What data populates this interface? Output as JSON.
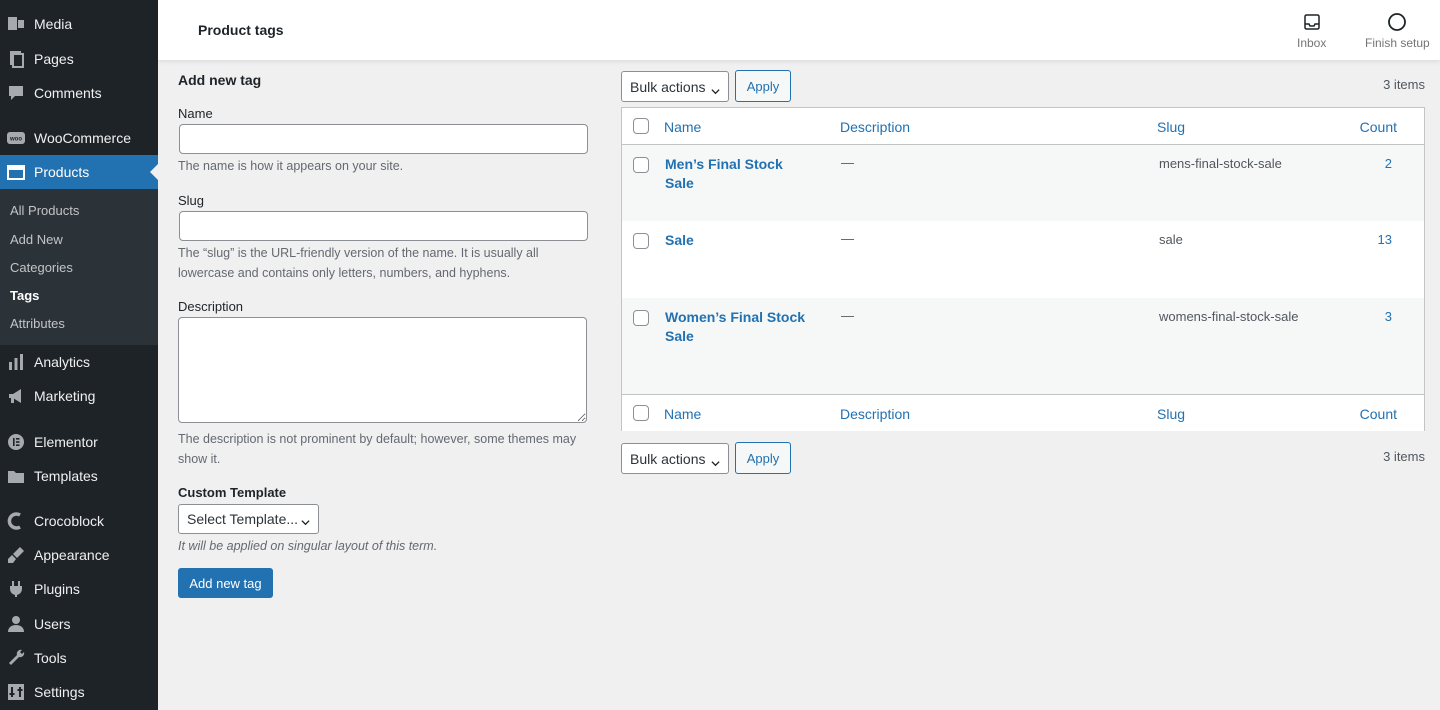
{
  "sidebar": {
    "items": [
      {
        "label": "Media",
        "icon": "media-icon"
      },
      {
        "label": "Pages",
        "icon": "pages-icon"
      },
      {
        "label": "Comments",
        "icon": "comments-icon"
      },
      {
        "label": "WooCommerce",
        "icon": "woocommerce-icon"
      },
      {
        "label": "Products",
        "icon": "products-icon",
        "current": true
      },
      {
        "label": "Analytics",
        "icon": "analytics-icon"
      },
      {
        "label": "Marketing",
        "icon": "marketing-icon"
      },
      {
        "label": "Elementor",
        "icon": "elementor-icon"
      },
      {
        "label": "Templates",
        "icon": "templates-icon"
      },
      {
        "label": "Crocoblock",
        "icon": "crocoblock-icon"
      },
      {
        "label": "Appearance",
        "icon": "appearance-icon"
      },
      {
        "label": "Plugins",
        "icon": "plugins-icon"
      },
      {
        "label": "Users",
        "icon": "users-icon"
      },
      {
        "label": "Tools",
        "icon": "tools-icon"
      },
      {
        "label": "Settings",
        "icon": "settings-icon"
      }
    ],
    "submenu": [
      "All Products",
      "Add New",
      "Categories",
      "Tags",
      "Attributes"
    ],
    "woo_badge": "woo"
  },
  "topbar": {
    "title": "Product tags",
    "inbox_label": "Inbox",
    "finish_setup_label": "Finish setup"
  },
  "form": {
    "heading": "Add new tag",
    "name_label": "Name",
    "name_value": "",
    "name_help": "The name is how it appears on your site.",
    "slug_label": "Slug",
    "slug_value": "",
    "slug_help": "The “slug” is the URL-friendly version of the name. It is usually all lowercase and contains only letters, numbers, and hyphens.",
    "description_label": "Description",
    "description_help": "The description is not prominent by default; however, some themes may show it.",
    "custom_template_label": "Custom Template",
    "custom_template_value": "Select Template...",
    "custom_template_help": "It will be applied on singular layout of this term.",
    "submit_label": "Add new tag"
  },
  "bulk": {
    "actions_label": "Bulk actions",
    "apply_label": "Apply",
    "items_count": "3 items"
  },
  "table": {
    "columns": [
      "Name",
      "Description",
      "Slug",
      "Count"
    ],
    "rows": [
      {
        "name": "Men’s Final Stock Sale",
        "description": "—",
        "slug": "mens-final-stock-sale",
        "count": "2"
      },
      {
        "name": "Sale",
        "description": "—",
        "slug": "sale",
        "count": "13"
      },
      {
        "name": "Women’s Final Stock Sale",
        "description": "—",
        "slug": "womens-final-stock-sale",
        "count": "3"
      }
    ]
  },
  "colors": {
    "accent": "#2271b1",
    "sidebar_bg": "#1d2327",
    "submenu_bg": "#2c3338"
  }
}
